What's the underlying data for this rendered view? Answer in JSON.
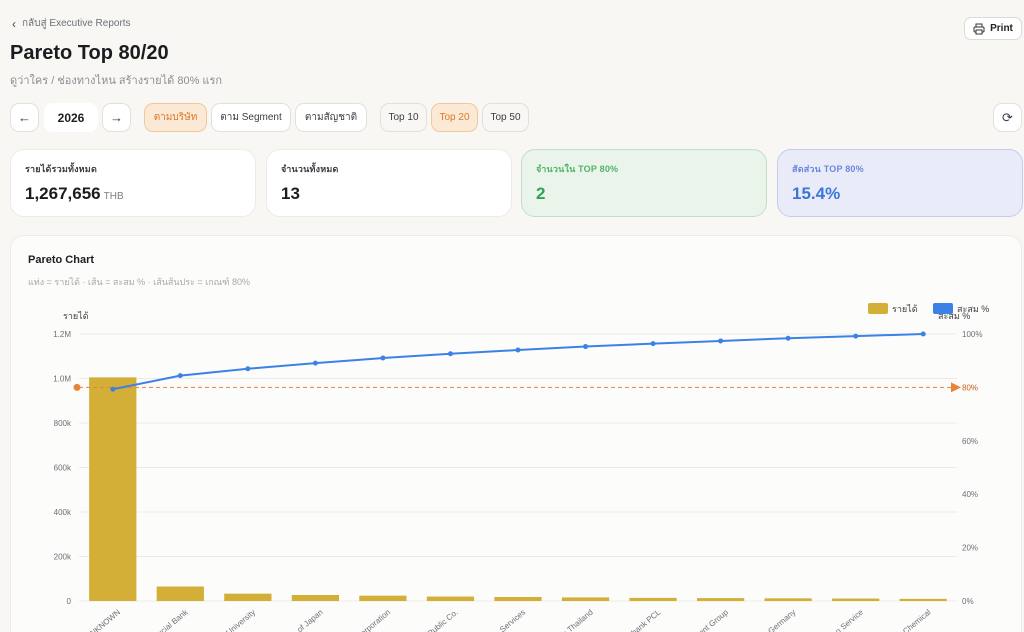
{
  "header": {
    "back_label": "กลับสู่ Executive Reports",
    "title": "Pareto Top 80/20",
    "subtitle": "ดูว่าใคร / ช่องทางไหน สร้างรายได้ 80% แรก",
    "print_label": "Print"
  },
  "toolbar": {
    "year": "2026",
    "group_tabs": [
      "ตามบริษัท",
      "ตาม Segment",
      "ตามสัญชาติ"
    ],
    "active_group": "ตามบริษัท",
    "top_tabs": [
      "Top 10",
      "Top 20",
      "Top 50"
    ],
    "active_top": "Top 20"
  },
  "cards": [
    {
      "label": "รายได้รวมทั้งหมด",
      "value": "1,267,656",
      "unit": "THB",
      "style": "plain"
    },
    {
      "label": "จำนวนทั้งหมด",
      "value": "13",
      "unit": "",
      "style": "plain"
    },
    {
      "label": "จำนวนใน TOP 80%",
      "value": "2",
      "unit": "",
      "style": "green"
    },
    {
      "label": "สัดส่วน TOP 80%",
      "value": "15.4%",
      "unit": "",
      "style": "blue"
    }
  ],
  "chart_panel": {
    "title": "Pareto Chart",
    "description": "แท่ง = รายได้ · เส้น = สะสม % · เส้นส้นประ = เกณฑ์ 80%"
  },
  "chart_data": {
    "type": "bar",
    "ylabel_left": "รายได้",
    "ylabel_right": "สะสม %",
    "ylim_left": [
      0,
      1200000
    ],
    "yticks_left": [
      "0",
      "200k",
      "400k",
      "600k",
      "800k",
      "1.0M",
      "1.2M"
    ],
    "ylim_right": [
      0,
      100
    ],
    "yticks_right": [
      "0%",
      "20%",
      "40%",
      "60%",
      "80%",
      "100%"
    ],
    "threshold_label": "80%",
    "threshold": 80,
    "grid": true,
    "legend_position": "top-right",
    "categories": [
      "UNKNOWN",
      "...rcial Bank",
      "...University",
      "... of Japan",
      "...Corporation",
      "...Public Co.",
      "... Services",
      "...e Thailand",
      "...bank PCL",
      "...ent Group",
      "... Germany",
      "...o Service",
      "...Chemical"
    ],
    "series": [
      {
        "name": "รายได้",
        "color": "#d4af37",
        "values": [
          1005000,
          65000,
          33000,
          27000,
          24000,
          20000,
          18000,
          16000,
          14000,
          13000,
          12000,
          11000,
          9656
        ]
      },
      {
        "name": "สะสม %",
        "color": "#3b82e6",
        "values": [
          79.3,
          84.4,
          87.0,
          89.1,
          91.0,
          92.6,
          94.0,
          95.3,
          96.4,
          97.4,
          98.4,
          99.2,
          100
        ]
      }
    ]
  }
}
